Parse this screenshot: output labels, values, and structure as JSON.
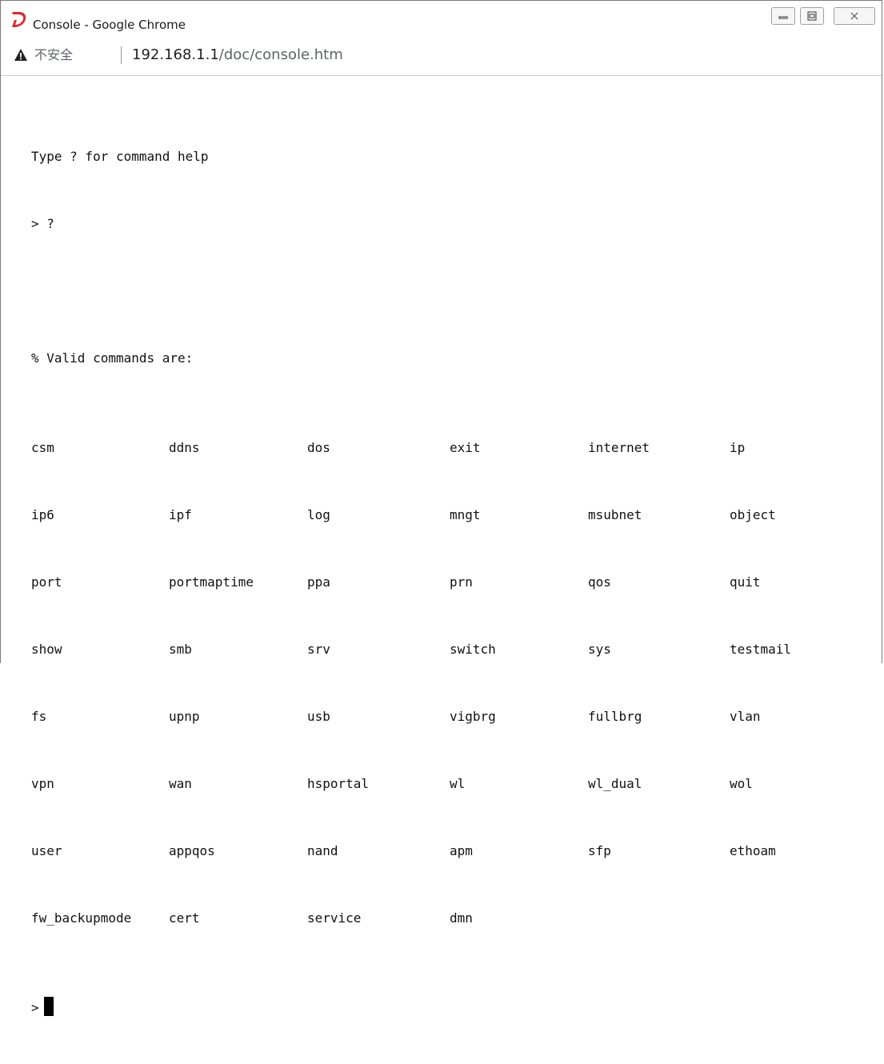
{
  "window": {
    "title": "Console - Google Chrome"
  },
  "addressbar": {
    "security_label": "不安全",
    "url_host": "192.168.1.1",
    "url_path": "/doc/console.htm"
  },
  "console": {
    "intro": "Type ? for command help",
    "prompt1": "> ?",
    "blank": "",
    "header": "% Valid commands are:",
    "commands": [
      [
        "csm",
        "ddns",
        "dos",
        "exit",
        "internet",
        "ip"
      ],
      [
        "ip6",
        "ipf",
        "log",
        "mngt",
        "msubnet",
        "object"
      ],
      [
        "port",
        "portmaptime",
        "ppa",
        "prn",
        "qos",
        "quit"
      ],
      [
        "show",
        "smb",
        "srv",
        "switch",
        "sys",
        "testmail"
      ],
      [
        "fs",
        "upnp",
        "usb",
        "vigbrg",
        "fullbrg",
        "vlan"
      ],
      [
        "vpn",
        "wan",
        "hsportal",
        "wl",
        "wl_dual",
        "wol"
      ],
      [
        "user",
        "appqos",
        "nand",
        "apm",
        "sfp",
        "ethoam"
      ],
      [
        "fw_backupmode",
        "cert",
        "service",
        "dmn",
        "",
        ""
      ]
    ],
    "prompt2": ">"
  }
}
